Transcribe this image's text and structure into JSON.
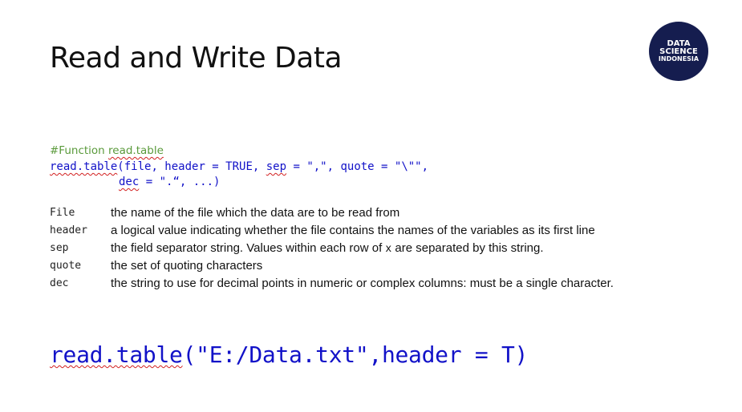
{
  "slide": {
    "title": "Read and Write Data",
    "logo": {
      "line1": "DATA",
      "line2": "SCIENCE",
      "line3": "INDONESIA",
      "background_color": "#151d4f"
    },
    "comment": {
      "prefix": "#Function ",
      "name": "read.table"
    },
    "code": {
      "line1_fn": "read.table",
      "line1_rest_a": "(file, header = TRUE, ",
      "line1_sep": "sep",
      "line1_rest_b": " = \",\", quote = \"\\\"\",",
      "line2_dec": "dec",
      "line2_rest": " = \".“, ...)"
    },
    "arguments": [
      {
        "name": "File",
        "description": "the name of the file which the data are to be read from"
      },
      {
        "name": "header",
        "description": "a logical value indicating whether the file contains the names of the variables as its first line"
      },
      {
        "name": "sep",
        "description_before": "the field separator string. Values within each row of ",
        "description_code": "x",
        "description_after": " are separated by this string."
      },
      {
        "name": "quote",
        "description": "the set of quoting characters"
      },
      {
        "name": "dec",
        "description": "the string to use for decimal points in numeric or complex columns: must be a single character."
      }
    ],
    "example": {
      "fn": "read.table",
      "args": "(\"E:/Data.txt\",header = T)"
    },
    "colors": {
      "code_blue": "#1212c8",
      "comment_green": "#5a9a3b",
      "spellcheck_red": "#d22020"
    }
  }
}
